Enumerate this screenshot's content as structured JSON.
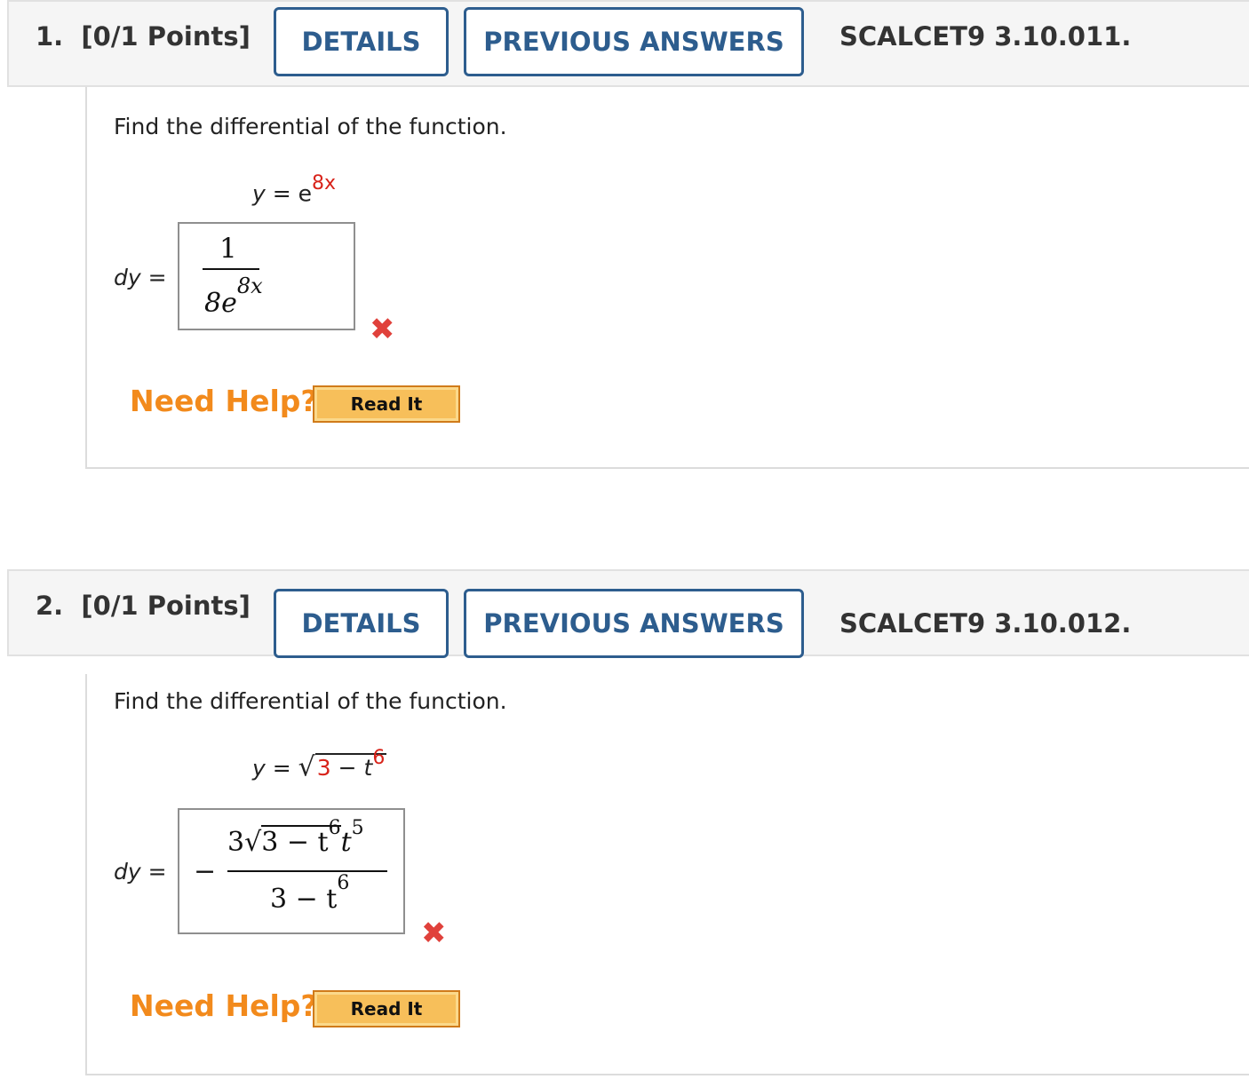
{
  "questions": [
    {
      "number_label": "1.",
      "points": "[0/1 Points]",
      "details_label": "DETAILS",
      "previous_answers_label": "PREVIOUS ANSWERS",
      "code": "SCALCET9 3.10.011.",
      "prompt": "Find the differential of the function.",
      "function": {
        "lhs": "y",
        "eq": " = ",
        "base": "e",
        "exponent": "8x"
      },
      "answer_label": {
        "var": "dy",
        "eq": " ="
      },
      "answer": {
        "numerator": "1",
        "denominator_coeff": "8e",
        "denominator_exp": "8x"
      },
      "status_icon": "incorrect-x-icon",
      "need_help": "Need Help?",
      "read_it": "Read It"
    },
    {
      "number_label": "2.",
      "points": "[0/1 Points]",
      "details_label": "DETAILS",
      "previous_answers_label": "PREVIOUS ANSWERS",
      "code": "SCALCET9 3.10.012.",
      "prompt": "Find the differential of the function.",
      "function": {
        "lhs": "y",
        "eq": " = ",
        "radicand_const": "3",
        "minus": " − ",
        "var": "t",
        "exponent": "6"
      },
      "answer_label": {
        "var": "dy",
        "eq": " ="
      },
      "answer": {
        "sign": "−",
        "num_coeff": "3",
        "num_radicand": "3 − t",
        "num_radicand_exp": "6",
        "num_tail_var": "t",
        "num_tail_exp": "5",
        "den_text": "3 − t",
        "den_exp": "6"
      },
      "status_icon": "incorrect-x-icon",
      "need_help": "Need Help?",
      "read_it": "Read It"
    }
  ],
  "colors": {
    "accent": "#2d5d8e",
    "error": "#e0413b",
    "help": "#f28a1c",
    "highlight": "#d8231a"
  }
}
